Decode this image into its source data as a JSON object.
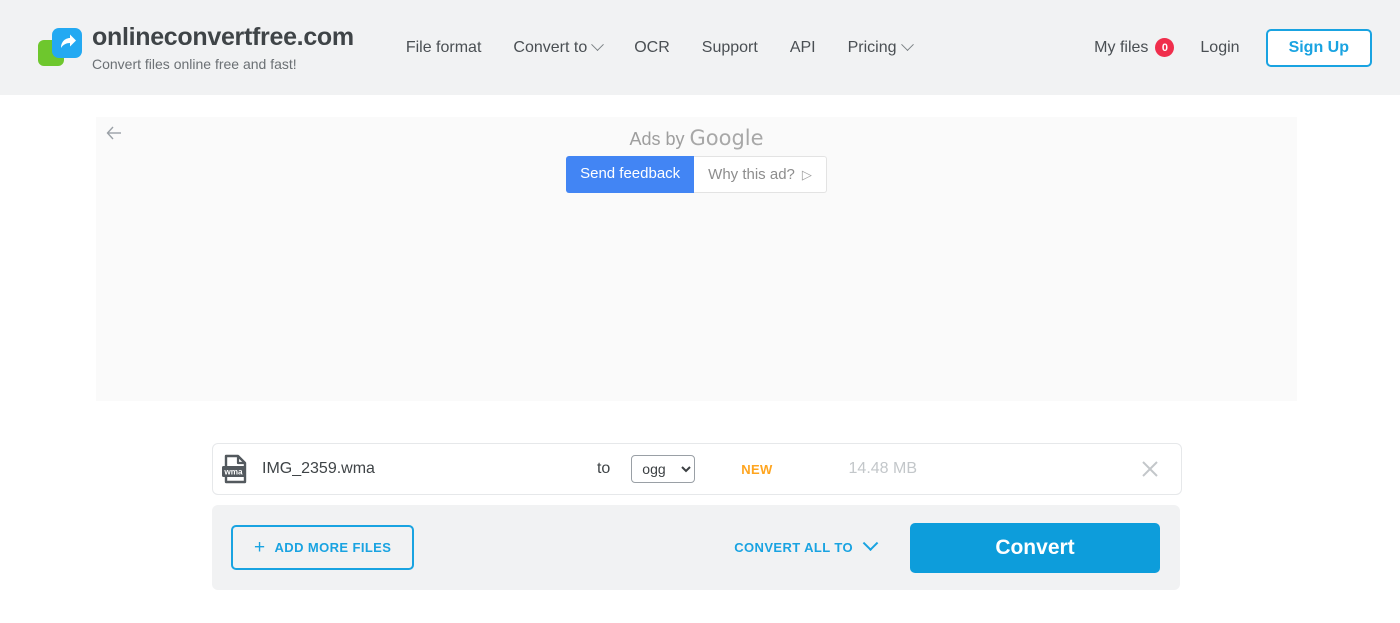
{
  "header": {
    "brand_title": "onlineconvertfree.com",
    "brand_tagline": "Convert files online free and fast!",
    "nav": [
      {
        "label": "File format",
        "has_caret": false
      },
      {
        "label": "Convert to",
        "has_caret": true
      },
      {
        "label": "OCR",
        "has_caret": false
      },
      {
        "label": "Support",
        "has_caret": false
      },
      {
        "label": "API",
        "has_caret": false
      },
      {
        "label": "Pricing",
        "has_caret": true
      }
    ],
    "my_files_label": "My files",
    "my_files_count": "0",
    "login_label": "Login",
    "signup_label": "Sign Up",
    "accent_color": "#19a3e1",
    "badge_color": "#f02e4c"
  },
  "ad": {
    "ads_by_prefix": "Ads by ",
    "ads_by_brand": "Google",
    "send_feedback_label": "Send feedback",
    "why_this_ad_label": "Why this ad?",
    "why_this_ad_icon": "play-triangle-icon",
    "feedback_color": "#4285f4"
  },
  "file_row": {
    "icon_extension": "wma",
    "file_name": "IMG_2359.wma",
    "to_label": "to",
    "target_format": "ogg",
    "format_options": [
      "ogg"
    ],
    "new_label": "NEW",
    "new_color": "#ffa51f",
    "file_size": "14.48 MB"
  },
  "actions": {
    "add_more_label": "ADD MORE FILES",
    "convert_all_label": "CONVERT ALL TO",
    "convert_label": "Convert",
    "convert_color": "#0d9ddb"
  }
}
